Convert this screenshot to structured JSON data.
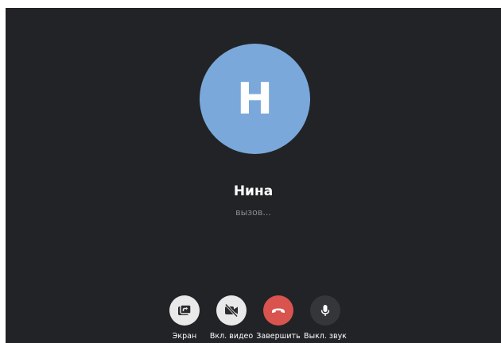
{
  "contact": {
    "initial": "Н",
    "name": "Нина",
    "status": "вызов..."
  },
  "controls": [
    {
      "label": "Экран",
      "icon": "screen-share-icon",
      "color": "#e9e9e9"
    },
    {
      "label": "Вкл. видео",
      "icon": "video-off-icon",
      "color": "#e9e9e9"
    },
    {
      "label": "Завершить",
      "icon": "phone-hangup-icon",
      "color": "#d9534f"
    },
    {
      "label": "Выкл. звук",
      "icon": "microphone-icon",
      "color": "#34363a"
    }
  ],
  "colors": {
    "background": "#222326",
    "avatar": "#7aa8da",
    "hangup": "#d9534f"
  }
}
